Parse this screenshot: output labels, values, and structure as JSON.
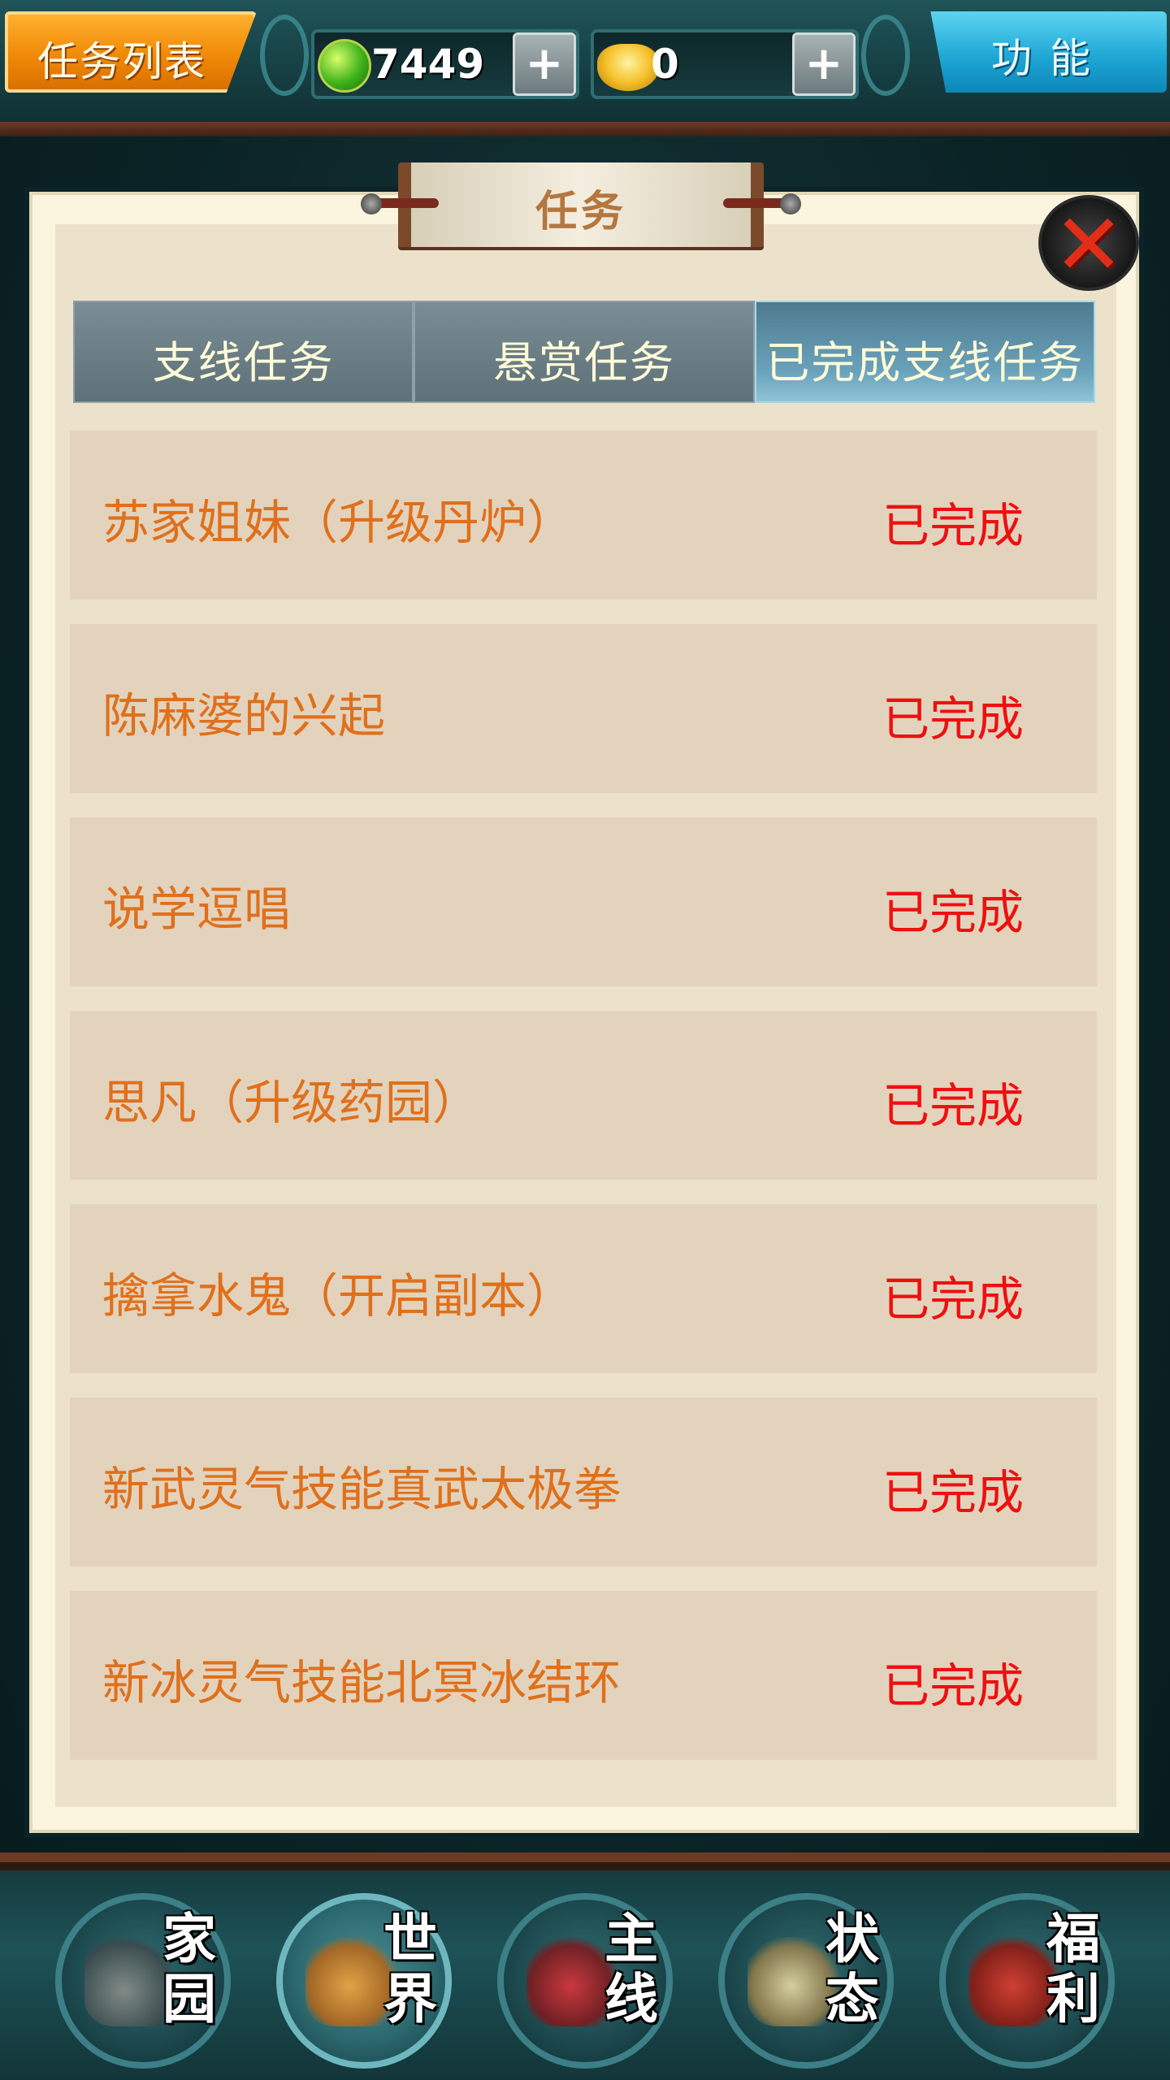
{
  "header": {
    "title": "任务列表",
    "jade_amount": "7449",
    "gold_amount": "0",
    "plus_symbol": "+",
    "function_label": "功能"
  },
  "panel": {
    "title": "任务",
    "close_symbol": "✕"
  },
  "tabs": [
    {
      "label": "支线任务",
      "active": false
    },
    {
      "label": "悬赏任务",
      "active": false
    },
    {
      "label": "已完成支线任务",
      "active": true
    }
  ],
  "quests": [
    {
      "name": "苏家姐妹（升级丹炉）",
      "status": "已完成"
    },
    {
      "name": "陈麻婆的兴起",
      "status": "已完成"
    },
    {
      "name": "说学逗唱",
      "status": "已完成"
    },
    {
      "name": "思凡（升级药园）",
      "status": "已完成"
    },
    {
      "name": "擒拿水鬼（开启副本）",
      "status": "已完成"
    },
    {
      "name": "新武灵气技能真武太极拳",
      "status": "已完成"
    },
    {
      "name": "新冰灵气技能北冥冰结环",
      "status": "已完成"
    }
  ],
  "nav": [
    {
      "label": "家园",
      "icon": "home-icon",
      "active": false
    },
    {
      "label": "世界",
      "icon": "world-map-icon",
      "active": true
    },
    {
      "label": "主线",
      "icon": "main-quest-icon",
      "active": false
    },
    {
      "label": "状态",
      "icon": "bagua-scroll-icon",
      "active": false
    },
    {
      "label": "福利",
      "icon": "gift-bag-icon",
      "active": false
    }
  ],
  "colors": {
    "quest_name": "#e0701c",
    "quest_status": "#ee1010",
    "active_tab": "#6aa2bb"
  }
}
